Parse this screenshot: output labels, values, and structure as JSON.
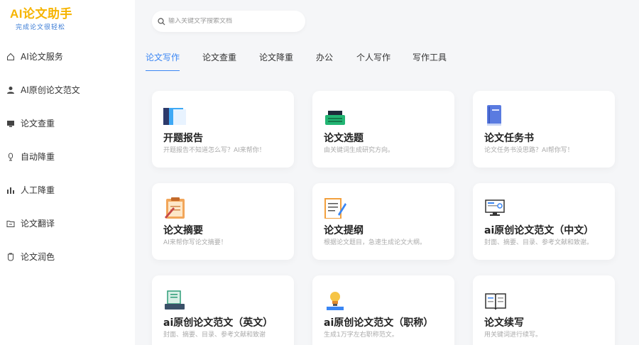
{
  "app": {
    "title": "AI论文助手",
    "subtitle": "完成论文很轻松"
  },
  "search": {
    "placeholder": "输入关键文字搜索文档"
  },
  "sidebar": {
    "items": [
      {
        "label": "AI论文服务",
        "icon": "home-icon"
      },
      {
        "label": "AI原创论文范文",
        "icon": "user-icon"
      },
      {
        "label": "论文查重",
        "icon": "monitor-icon"
      },
      {
        "label": "自动降重",
        "icon": "microphone-icon"
      },
      {
        "label": "人工降重",
        "icon": "bar-chart-icon"
      },
      {
        "label": "论文翻译",
        "icon": "folder-icon"
      },
      {
        "label": "论文润色",
        "icon": "cup-icon"
      }
    ]
  },
  "tabs": [
    {
      "label": "论文写作",
      "active": true
    },
    {
      "label": "论文查重"
    },
    {
      "label": "论文降重"
    },
    {
      "label": "办公"
    },
    {
      "label": "个人写作"
    },
    {
      "label": "写作工具"
    }
  ],
  "cards": [
    {
      "title": "开题报告",
      "desc": "开题报告不知道怎么写？AI来帮你！",
      "icon": "report-icon"
    },
    {
      "title": "论文选题",
      "desc": "由关键词生成研究方向。",
      "icon": "typewriter-icon"
    },
    {
      "title": "论文任务书",
      "desc": "论文任务书没思路？AI帮你写！",
      "icon": "book-icon"
    },
    {
      "title": "论文摘要",
      "desc": "AI来帮你写论文摘要！",
      "icon": "clipboard-icon"
    },
    {
      "title": "论文提纲",
      "desc": "根据论文题目，急速生成论文大纲。",
      "icon": "outline-icon"
    },
    {
      "title": "ai原创论文范文（中文）",
      "desc": "封面、摘要、目录、参考文献和致谢。",
      "icon": "computer-icon"
    },
    {
      "title": "ai原创论文范文（英文）",
      "desc": "封面、摘要、目录、参考文献和致谢",
      "icon": "keyboard-icon"
    },
    {
      "title": "ai原创论文范文（职称）",
      "desc": "生成1万字左右职称范文。",
      "icon": "lightbulb-icon"
    },
    {
      "title": "论文续写",
      "desc": "用关键词进行续写。",
      "icon": "open-book-icon"
    }
  ],
  "colors": {
    "accent": "#3a86f4",
    "logo": "#f6b400",
    "background": "#f5f6f8"
  }
}
